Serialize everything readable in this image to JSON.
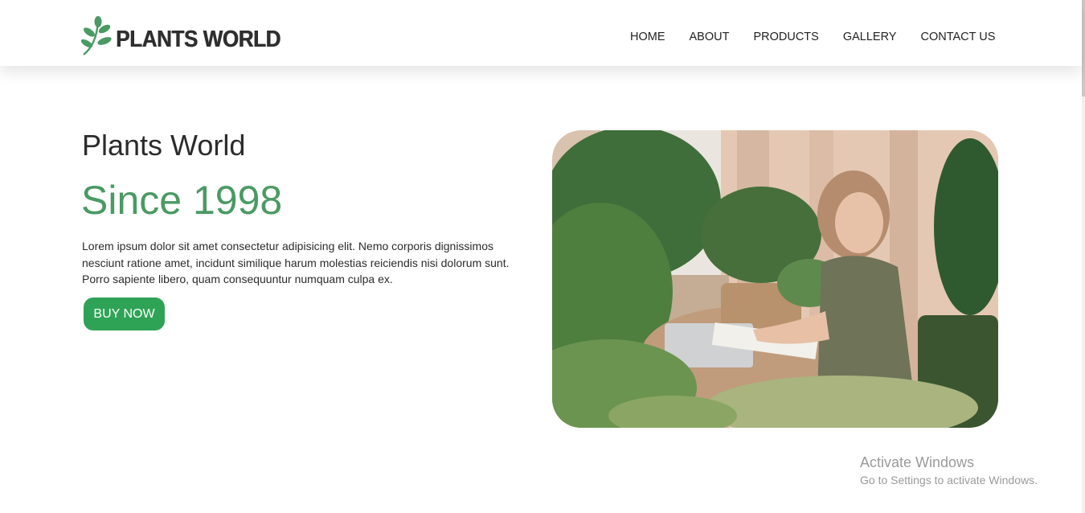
{
  "header": {
    "brand": "PLANTS WORLD",
    "nav": [
      "HOME",
      "ABOUT",
      "PRODUCTS",
      "GALLERY",
      "CONTACT US"
    ]
  },
  "hero": {
    "subtitle": "Plants World",
    "title": "Since 1998",
    "text": "Lorem ipsum dolor sit amet consectetur adipisicing elit. Nemo corporis dignissimos nesciunt ratione amet, incidunt similique harum molestias reiciendis nisi dolorum sunt. Porro sapiente libero, quam consequuntur numquam culpa ex.",
    "button": "BUY NOW"
  },
  "watermark": {
    "line1": "Activate Windows",
    "line2": "Go to Settings to activate Windows."
  },
  "colors": {
    "accent": "#4a9a63",
    "button": "#2ea356",
    "text": "#2b2b2b"
  },
  "icons": [
    "leaf-logo-icon"
  ]
}
